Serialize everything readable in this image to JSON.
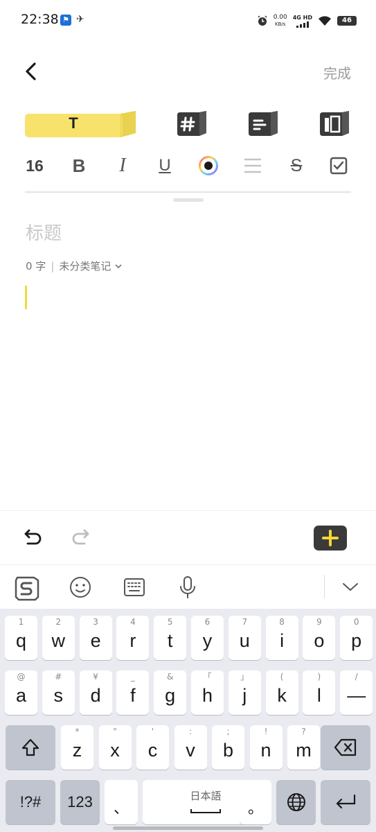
{
  "status": {
    "time": "22:38",
    "net_speed_value": "0.00",
    "net_speed_unit": "KB/s",
    "signal": "4G HD",
    "battery": "46"
  },
  "header": {
    "done_label": "完成"
  },
  "style_tabs": {
    "text_label": "T"
  },
  "format": {
    "font_size": "16",
    "bold": "B",
    "italic": "I",
    "underline": "U",
    "strike": "S"
  },
  "editor": {
    "title_placeholder": "标题",
    "word_count": "0 字",
    "separator": "|",
    "category": "未分类笔记"
  },
  "icons": {
    "back": "back-arrow-icon",
    "heading": "hash-icon",
    "paragraph": "text-lines-icon",
    "layout": "layout-columns-icon",
    "color": "color-picker-icon",
    "align": "align-lines-icon",
    "checkbox": "checkbox-icon",
    "undo": "undo-icon",
    "redo": "redo-icon",
    "add": "plus-icon",
    "ime_logo": "sogou-logo-icon",
    "emoji": "emoji-icon",
    "keyboard": "keyboard-icon",
    "mic": "microphone-icon",
    "collapse": "chevron-down-icon"
  },
  "colors": {
    "accent_yellow": "#f7e36c",
    "caret": "#f2d93a",
    "key_dark": "#bfc4ce",
    "keyboard_bg": "#e9ebf0"
  },
  "keyboard": {
    "row1": [
      {
        "hint": "1",
        "key": "q"
      },
      {
        "hint": "2",
        "key": "w"
      },
      {
        "hint": "3",
        "key": "e"
      },
      {
        "hint": "4",
        "key": "r"
      },
      {
        "hint": "5",
        "key": "t"
      },
      {
        "hint": "6",
        "key": "y"
      },
      {
        "hint": "7",
        "key": "u"
      },
      {
        "hint": "8",
        "key": "i"
      },
      {
        "hint": "9",
        "key": "o"
      },
      {
        "hint": "0",
        "key": "p"
      }
    ],
    "row2": [
      {
        "hint": "@",
        "key": "a"
      },
      {
        "hint": "#",
        "key": "s"
      },
      {
        "hint": "¥",
        "key": "d"
      },
      {
        "hint": "_",
        "key": "f"
      },
      {
        "hint": "&",
        "key": "g"
      },
      {
        "hint": "「",
        "key": "h"
      },
      {
        "hint": "」",
        "key": "j"
      },
      {
        "hint": "(",
        "key": "k"
      },
      {
        "hint": ")",
        "key": "l"
      },
      {
        "hint": "/",
        "key": "—"
      }
    ],
    "row3": [
      {
        "hint": "*",
        "key": "z"
      },
      {
        "hint": "\"",
        "key": "x"
      },
      {
        "hint": "'",
        "key": "c"
      },
      {
        "hint": ":",
        "key": "v"
      },
      {
        "hint": ";",
        "key": "b"
      },
      {
        "hint": "!",
        "key": "n"
      },
      {
        "hint": "?",
        "key": "m"
      }
    ],
    "symbols_label": "!?#",
    "numbers_label": "123",
    "comma_label": "、",
    "space_label": "日本語",
    "period_label": "。"
  }
}
